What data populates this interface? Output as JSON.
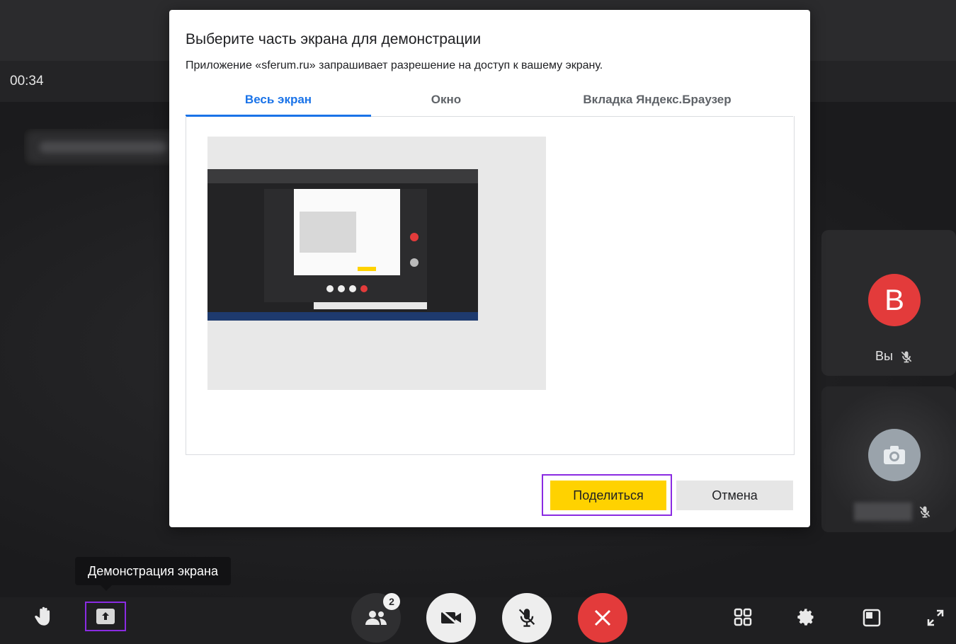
{
  "call": {
    "timer": "00:34"
  },
  "dialog": {
    "title": "Выберите часть экрана для демонстрации",
    "subtitle": "Приложение «sferum.ru» запрашивает разрешение на доступ к вашему экрану.",
    "tabs": [
      {
        "label": "Весь экран",
        "active": true
      },
      {
        "label": "Окно",
        "active": false
      },
      {
        "label": "Вкладка Яндекс.Браузер",
        "active": false
      }
    ],
    "share_label": "Поделиться",
    "cancel_label": "Отмена"
  },
  "participants": {
    "you": {
      "initial": "В",
      "label": "Вы"
    },
    "count_badge": "2"
  },
  "tooltip": "Демонстрация экрана",
  "colors": {
    "accent": "#1a73e8",
    "share": "#ffd200",
    "end_call": "#e33b3b",
    "highlight": "#8a2be2"
  }
}
